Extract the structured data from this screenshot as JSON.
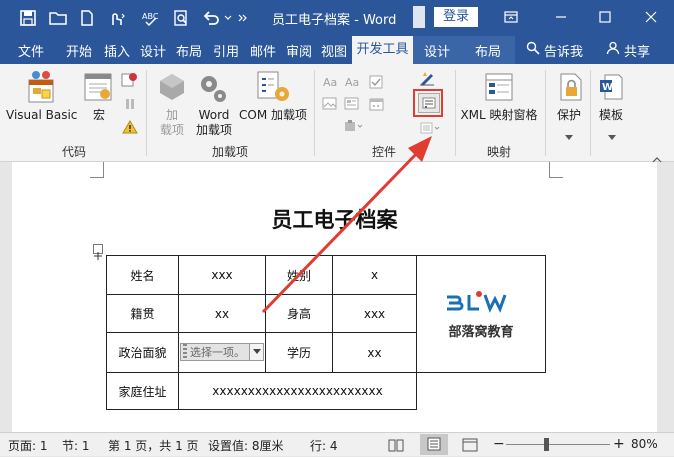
{
  "titlebar": {
    "doc_title": "员工电子档案 - Word",
    "login": "登录"
  },
  "tabs": {
    "file": "文件",
    "home": "开始",
    "insert": "插入",
    "design": "设计",
    "layout": "布局",
    "references": "引用",
    "mailings": "邮件",
    "review": "审阅",
    "view": "视图",
    "developer": "开发工具",
    "table_design": "设计",
    "table_layout": "布局",
    "tell_me": "告诉我",
    "share": "共享"
  },
  "ribbon": {
    "code": {
      "visual_basic": "Visual Basic",
      "macros": "宏",
      "group": "代码"
    },
    "addins": {
      "addins_line1": "加",
      "addins_line2": "载项",
      "word_line1": "Word",
      "word_line2": "加载项",
      "com": "COM 加载项",
      "group": "加载项"
    },
    "controls": {
      "group": "控件"
    },
    "mapping": {
      "xml": "XML 映射窗格",
      "group": "映射"
    },
    "protect": {
      "protect": "保护"
    },
    "templates": {
      "template": "模板"
    }
  },
  "document": {
    "heading": "员工电子档案",
    "table": {
      "name_label": "姓名",
      "name_value": "xxx",
      "gender_label": "姓别",
      "gender_value": "x",
      "origin_label": "籍贯",
      "origin_value": "xx",
      "height_label": "身高",
      "height_value": "xxx",
      "politics_label": "政治面貌",
      "politics_placeholder": "选择一项。",
      "edu_label": "学历",
      "edu_value": "xx",
      "address_label": "家庭住址",
      "address_value": "xxxxxxxxxxxxxxxxxxxxxxxx",
      "logo_text": "部落窝教育"
    }
  },
  "statusbar": {
    "page": "页面: 1",
    "section": "节: 1",
    "page_of": "第 1 页，共 1 页",
    "position": "设置值: 8厘米",
    "line": "行: 4",
    "zoom": "80%"
  },
  "colors": {
    "word_blue": "#2b579a",
    "highlight_red": "#e03c31",
    "logo_blue": "#1a6fb3"
  }
}
